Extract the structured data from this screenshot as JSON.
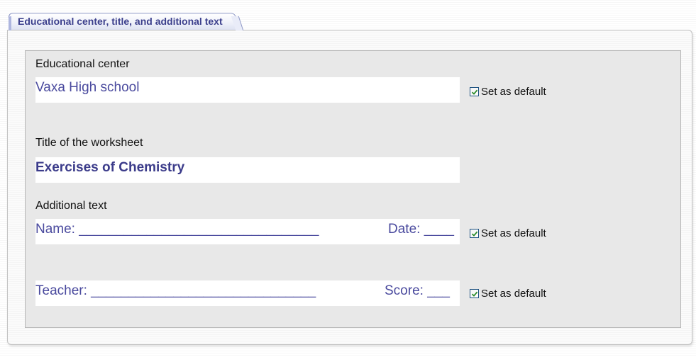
{
  "tab": {
    "label": "Educational center, title, and additional text"
  },
  "educational_center": {
    "label": "Educational center",
    "value": "Vaxa High school",
    "default_checkbox": {
      "label": "Set as default",
      "checked": true
    }
  },
  "worksheet_title": {
    "label": "Title of the worksheet",
    "value": "Exercises of Chemistry"
  },
  "additional_text": {
    "label": "Additional text",
    "line1": {
      "left": "Name: ________________________________",
      "right": "Date: ____",
      "default_checkbox": {
        "label": "Set as default",
        "checked": true
      }
    },
    "line2": {
      "left": "Teacher: ______________________________",
      "right": "Score: ___",
      "default_checkbox": {
        "label": "Set as default",
        "checked": true
      }
    }
  },
  "colors": {
    "tab_text": "#3b3f8c",
    "field_text": "#4a4a9e",
    "checkbox_check": "#2a8a2a"
  }
}
